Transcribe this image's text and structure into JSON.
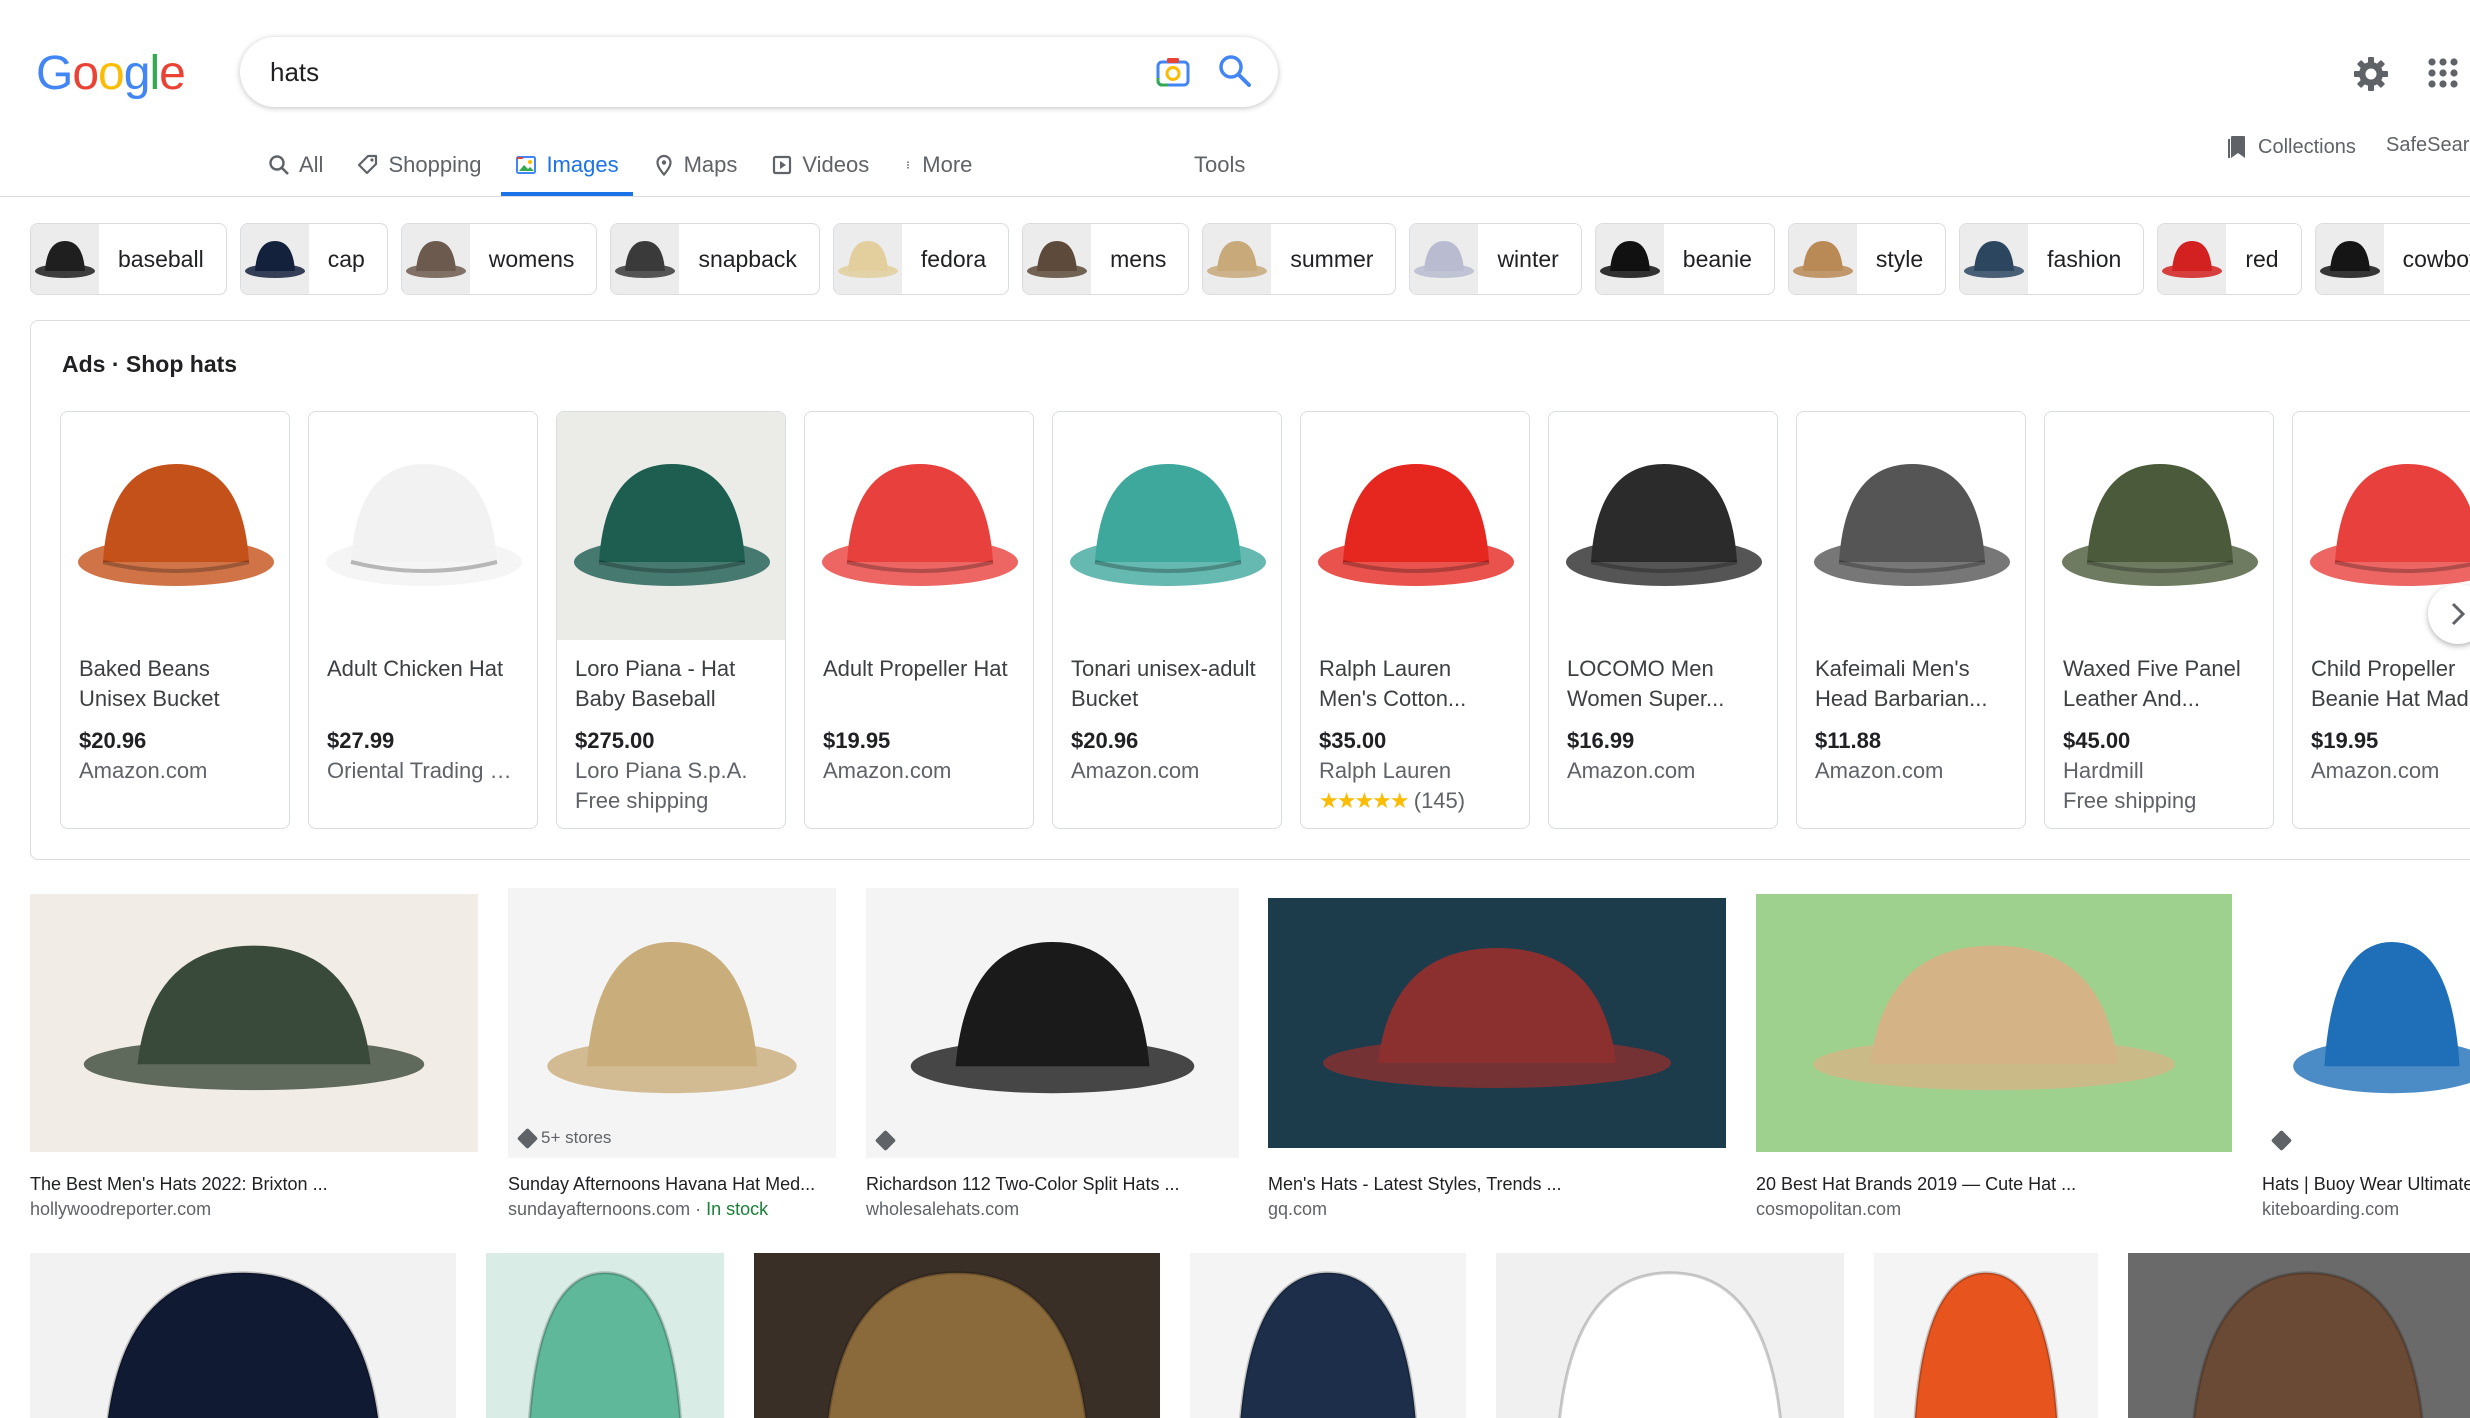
{
  "logo": {
    "letters": [
      "G",
      "o",
      "o",
      "g",
      "l",
      "e"
    ],
    "colors": [
      "#4285f4",
      "#ea4335",
      "#fbbc05",
      "#4285f4",
      "#34a853",
      "#ea4335"
    ]
  },
  "search": {
    "value": "hats"
  },
  "header_right": {
    "collections_label": "Collections",
    "safesearch_label": "SafeSearch"
  },
  "tabs": [
    {
      "label": "All",
      "icon": "search-icon",
      "active": false
    },
    {
      "label": "Shopping",
      "icon": "tag-icon",
      "active": false
    },
    {
      "label": "Images",
      "icon": "image-icon",
      "active": true
    },
    {
      "label": "Maps",
      "icon": "map-pin-icon",
      "active": false
    },
    {
      "label": "Videos",
      "icon": "play-icon",
      "active": false
    },
    {
      "label": "More",
      "icon": "more-vert-icon",
      "active": false
    }
  ],
  "tools_label": "Tools",
  "chips": [
    {
      "label": "baseball",
      "color": "#1f1f1f"
    },
    {
      "label": "cap",
      "color": "#14213d"
    },
    {
      "label": "womens",
      "color": "#6d5a4e"
    },
    {
      "label": "snapback",
      "color": "#3a3a3a"
    },
    {
      "label": "fedora",
      "color": "#e2cf9d"
    },
    {
      "label": "mens",
      "color": "#5d4a3a"
    },
    {
      "label": "summer",
      "color": "#c8a97a"
    },
    {
      "label": "winter",
      "color": "#b9bcd0"
    },
    {
      "label": "beanie",
      "color": "#111111"
    },
    {
      "label": "style",
      "color": "#b98a55"
    },
    {
      "label": "fashion",
      "color": "#2d4660"
    },
    {
      "label": "red",
      "color": "#d32020"
    },
    {
      "label": "cowboy",
      "color": "#151515"
    }
  ],
  "ads": {
    "prefix": "Ads",
    "separator": "·",
    "title": "Shop hats",
    "items": [
      {
        "title": "Baked Beans Unisex Bucket Ha...",
        "price": "$20.96",
        "seller": "Amazon.com",
        "extra": "",
        "color": "#c4511a",
        "bg": "#ffffff"
      },
      {
        "title": "Adult Chicken Hat",
        "price": "$27.99",
        "seller": "Oriental Trading C...",
        "extra": "",
        "color": "#f2f2f2",
        "bg": "#ffffff"
      },
      {
        "title": "Loro Piana - Hat Baby Baseball Ca...",
        "price": "$275.00",
        "seller": "Loro Piana S.p.A.",
        "extra": "Free shipping",
        "color": "#1d5e51",
        "bg": "#ebebe8"
      },
      {
        "title": "Adult Propeller Hat",
        "price": "$19.95",
        "seller": "Amazon.com",
        "extra": "",
        "color": "#e8403c",
        "bg": "#ffffff"
      },
      {
        "title": "Tonari unisex-adult Bucket",
        "price": "$20.96",
        "seller": "Amazon.com",
        "extra": "",
        "color": "#3ea89c",
        "bg": "#ffffff"
      },
      {
        "title": "Ralph Lauren Men's Cotton...",
        "price": "$35.00",
        "seller": "Ralph Lauren",
        "extra": "",
        "rating": "★★★★★",
        "reviews": "(145)",
        "color": "#e52720",
        "bg": "#ffffff"
      },
      {
        "title": "LOCOMO Men Women Super...",
        "price": "$16.99",
        "seller": "Amazon.com",
        "extra": "",
        "color": "#2b2b2b",
        "bg": "#ffffff"
      },
      {
        "title": "Kafeimali Men's Head Barbarian...",
        "price": "$11.88",
        "seller": "Amazon.com",
        "extra": "",
        "color": "#555555",
        "bg": "#ffffff"
      },
      {
        "title": "Waxed Five Panel Leather And...",
        "price": "$45.00",
        "seller": "Hardmill",
        "extra": "Free shipping",
        "color": "#4a5a3a",
        "bg": "#ffffff"
      },
      {
        "title": "Child Propeller Beanie Hat Mad...",
        "price": "$19.95",
        "seller": "Amazon.com",
        "extra": "",
        "color": "#e8403c",
        "bg": "#ffffff"
      }
    ]
  },
  "results_row1": [
    {
      "title": "The Best Men's Hats 2022: Brixton ...",
      "site": "hollywoodreporter.com",
      "badge": "",
      "stock": "",
      "bg": "#f2ece6",
      "hat": "#3a4a3a"
    },
    {
      "title": "Sunday Afternoons Havana Hat Med...",
      "site": "sundayafternoons.com",
      "badge": "5+ stores",
      "stock": "In stock",
      "bg": "#f4f4f4",
      "hat": "#c9ad7b"
    },
    {
      "title": "Richardson 112 Two-Color Split Hats ...",
      "site": "wholesalehats.com",
      "badge": "",
      "stock": "",
      "bg": "#f4f4f4",
      "hat": "#1a1a1a"
    },
    {
      "title": "Men's Hats - Latest Styles, Trends ...",
      "site": "gq.com",
      "badge": "",
      "stock": "",
      "bg": "#1c3c4c",
      "hat": "#8b2f2f"
    },
    {
      "title": "20 Best Hat Brands 2019 — Cute Hat ...",
      "site": "cosmopolitan.com",
      "badge": "",
      "stock": "",
      "bg": "#9fd18e",
      "hat": "#d4b486"
    },
    {
      "title": "Hats | Buoy Wear Ultimate...",
      "site": "kiteboarding.com",
      "badge": "",
      "stock": "",
      "bg": "#ffffff",
      "hat": "#1e6fb8"
    }
  ],
  "results_row2": [
    {
      "bg": "#f2f2f2",
      "hat": "#101a33"
    },
    {
      "bg": "#d9ede6",
      "hat": "#5fb89a"
    },
    {
      "bg": "#3a2f26",
      "hat": "#8a6a3a"
    },
    {
      "bg": "#f4f4f4",
      "hat": "#1c2e4a"
    },
    {
      "bg": "#f0f0f0",
      "hat": "#ffffff"
    },
    {
      "bg": "#f4f4f4",
      "hat": "#e8541e"
    },
    {
      "bg": "#6a6a6a",
      "hat": "#6b4a35"
    }
  ]
}
